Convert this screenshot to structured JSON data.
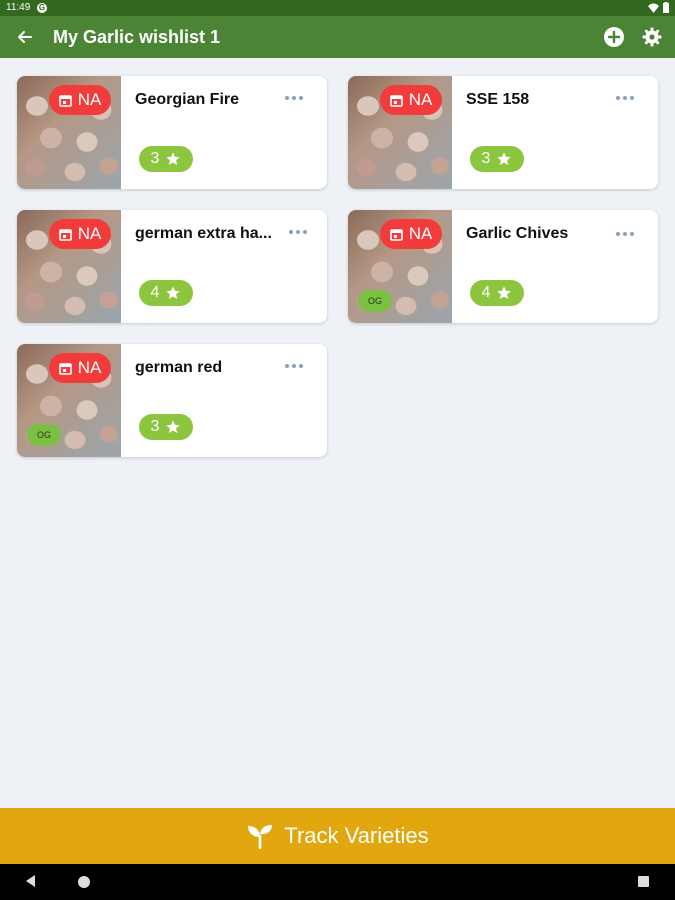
{
  "status_bar": {
    "time": "11:49"
  },
  "app_bar": {
    "title": "My Garlic wishlist 1"
  },
  "varieties": [
    {
      "name": "Georgian Fire",
      "badge": "NA",
      "rating": "3",
      "organic": ""
    },
    {
      "name": "SSE 158",
      "badge": "NA",
      "rating": "3",
      "organic": ""
    },
    {
      "name": "german extra ha...",
      "badge": "NA",
      "rating": "4",
      "organic": ""
    },
    {
      "name": "Garlic Chives",
      "badge": "NA",
      "rating": "4",
      "organic": "OG"
    },
    {
      "name": "german red",
      "badge": "NA",
      "rating": "3",
      "organic": "OG"
    }
  ],
  "footer": {
    "track_label": "Track Varieties"
  },
  "colors": {
    "app_bar": "#4c8436",
    "status_bar": "#33691e",
    "na_badge": "#f23b3b",
    "rating_badge": "#8cc63f",
    "og_badge": "#7bc043",
    "footer": "#e2a70e"
  },
  "icons": {
    "back": "arrow-left-icon",
    "add": "add-circle-icon",
    "settings": "gear-icon",
    "calendar": "calendar-icon",
    "star": "star-icon",
    "more": "more-horizontal-icon",
    "sprout": "sprout-icon"
  }
}
